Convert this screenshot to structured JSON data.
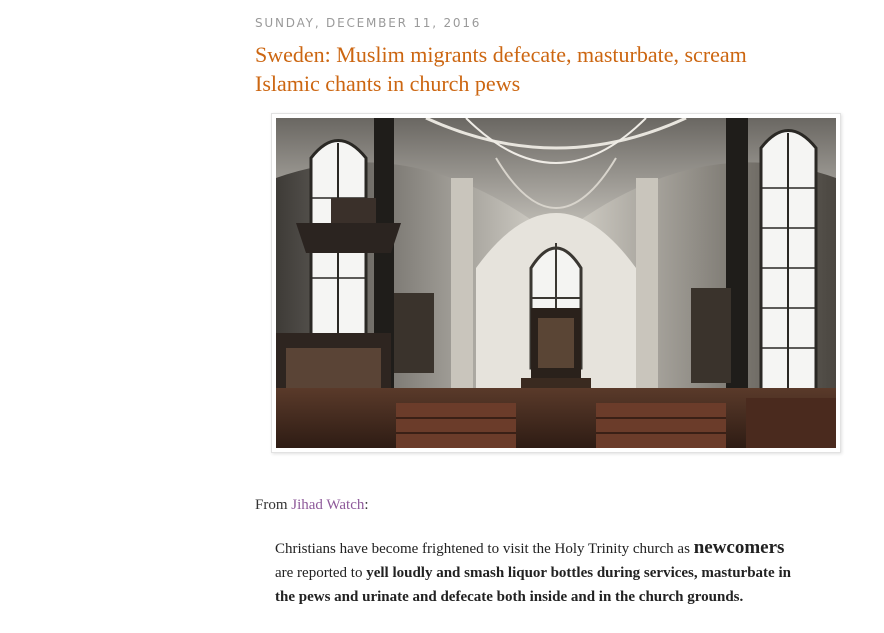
{
  "post": {
    "date": "SUNDAY, DECEMBER 11, 2016",
    "title": "Sweden: Muslim migrants defecate, masturbate, scream Islamic chants in church pews",
    "source_prefix": "From ",
    "source_link": "Jihad Watch",
    "source_suffix": ":",
    "quote": {
      "part1": "Christians have become frightened to visit the Holy Trinity church as ",
      "part2": "newcomers",
      "part3": " are reported to ",
      "part4": "yell loudly and smash liquor bottles during services, masturbate in the pews and urinate and defecate both inside and in the church grounds."
    }
  },
  "colors": {
    "title": "#cc6611",
    "date": "#9a9a9a",
    "link": "#8e5a9a"
  },
  "image": {
    "subject": "church-interior-photo"
  }
}
